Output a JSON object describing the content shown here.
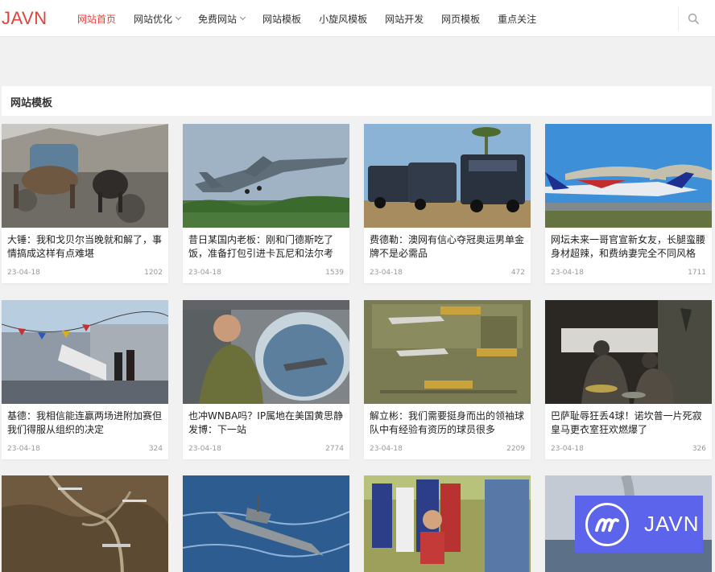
{
  "header": {
    "logo": "JAVN",
    "nav": [
      {
        "label": "网站首页",
        "active": true,
        "dropdown": false
      },
      {
        "label": "网站优化",
        "active": false,
        "dropdown": true
      },
      {
        "label": "免费网站",
        "active": false,
        "dropdown": true
      },
      {
        "label": "网站模板",
        "active": false,
        "dropdown": false
      },
      {
        "label": "小旋风模板",
        "active": false,
        "dropdown": false
      },
      {
        "label": "网站开发",
        "active": false,
        "dropdown": false
      },
      {
        "label": "网页模板",
        "active": false,
        "dropdown": false
      },
      {
        "label": "重点关注",
        "active": false,
        "dropdown": false
      }
    ],
    "search_icon": "search-icon"
  },
  "section": {
    "title": "网站模板"
  },
  "articles": [
    {
      "title": "大锤：我和戈贝尔当晚就和解了，事情搞成这样有点难堪",
      "date": "23-04-18",
      "views": "1202",
      "image": "mountain-yak"
    },
    {
      "title": "昔日某国内老板：刚和门德斯吃了饭，准备打包引进卡瓦尼和法尔考",
      "date": "23-04-18",
      "views": "1539",
      "image": "fighter-jet"
    },
    {
      "title": "费德勒：澳网有信心夺冠奥运男单金牌不是必需品",
      "date": "23-04-18",
      "views": "472",
      "image": "armored-vehicles"
    },
    {
      "title": "网坛未来一哥官宣新女友，长腿蛮腰身材超辣，和费纳妻完全不同风格",
      "date": "23-04-18",
      "views": "1711",
      "image": "aerobatic-jet"
    },
    {
      "title": "基德：我相信能连赢两场进附加赛但我们得服从组织的决定",
      "date": "23-04-18",
      "views": "324",
      "image": "ship-ceremony"
    },
    {
      "title": "也冲WNBA吗？IP属地在美国黄思静发博：下一站",
      "date": "23-04-18",
      "views": "2774",
      "image": "aircraft-window"
    },
    {
      "title": "解立彬：我们需要挺身而出的领袖球队中有经验有资历的球员很多",
      "date": "23-04-18",
      "views": "2209",
      "image": "infographic"
    },
    {
      "title": "巴萨耻辱狂丢4球！诺坎普一片死寂皇马更衣室狂欢燃爆了",
      "date": "23-04-18",
      "views": "326",
      "image": "night-market"
    },
    {
      "title": "",
      "date": "",
      "views": "",
      "image": "satellite-map"
    },
    {
      "title": "",
      "date": "",
      "views": "",
      "image": "warship"
    },
    {
      "title": "",
      "date": "",
      "views": "",
      "image": "students"
    },
    {
      "title": "",
      "date": "",
      "views": "",
      "image": "sea-smoke"
    }
  ],
  "watermark": {
    "text": "JAVN",
    "icon": "javn-logo-icon"
  },
  "colors": {
    "accent": "#e3413a",
    "watermark_bg": "#5b64ea"
  }
}
